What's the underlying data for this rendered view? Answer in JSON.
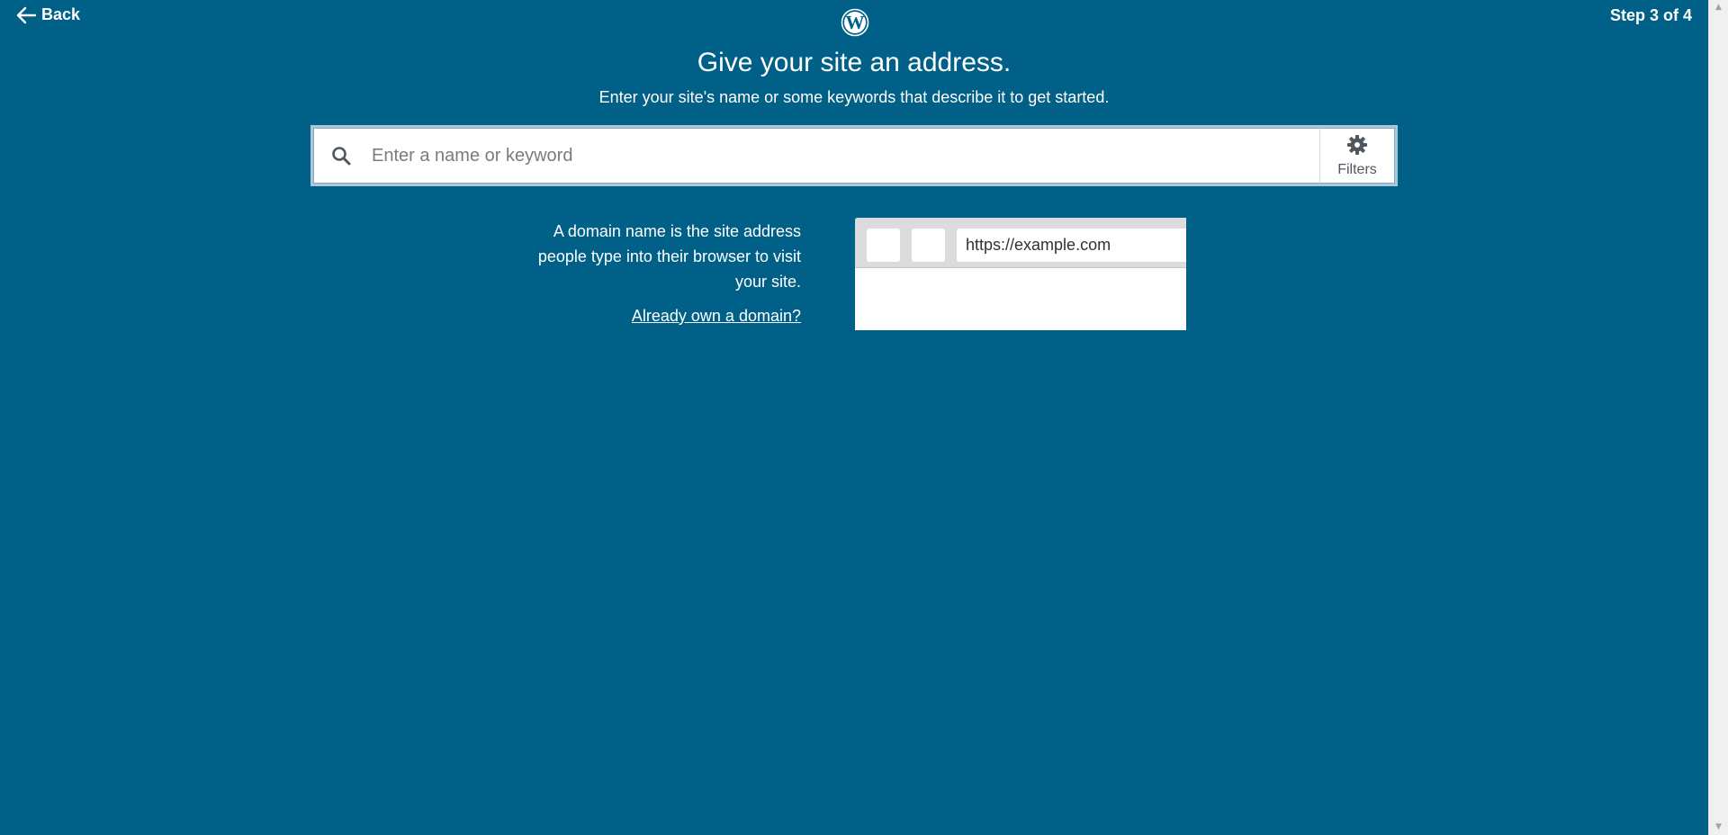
{
  "header": {
    "back_label": "Back",
    "step_label": "Step 3 of 4",
    "logo_icon": "wordpress-logo-icon"
  },
  "main": {
    "title": "Give your site an address.",
    "subtitle": "Enter your site's name or some keywords that describe it to get started."
  },
  "search": {
    "placeholder": "Enter a name or keyword",
    "value": "",
    "filters_label": "Filters",
    "search_icon": "search-icon",
    "filters_icon": "gear-icon"
  },
  "info": {
    "description": "A domain name is the site address people type into their browser to visit your site.",
    "own_domain_link": "Already own a domain?"
  },
  "illustration": {
    "url_text": "https://example.com"
  },
  "colors": {
    "background": "#006088",
    "text": "#ffffff"
  }
}
